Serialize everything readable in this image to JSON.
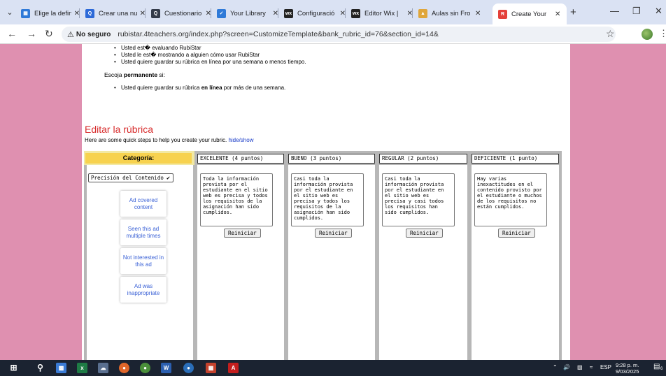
{
  "browser": {
    "tabs": [
      {
        "label": "Elige la defin",
        "icon": "microsoft-icon",
        "color": "#2f7ad8"
      },
      {
        "label": "Crear una nu",
        "icon": "quiz-icon",
        "color": "#2c69d8"
      },
      {
        "label": "Cuestionario",
        "icon": "quiz-icon",
        "color": "#333b4a"
      },
      {
        "label": "Your Library",
        "icon": "check-icon",
        "color": "#2f7ad8"
      },
      {
        "label": "Configuració",
        "icon": "wix-icon",
        "color": "#222222"
      },
      {
        "label": "Editor Wix |",
        "icon": "wix-icon",
        "color": "#222222"
      },
      {
        "label": "Aulas sin Fro",
        "icon": "aulas-icon",
        "color": "#e0a63a"
      },
      {
        "label": "Create Your",
        "icon": "rubistar-icon",
        "color": "#e4403a"
      }
    ],
    "address": {
      "security": "No seguro",
      "url": "rubistar.4teachers.org/index.php?screen=CustomizeTemplate&bank_rubric_id=76&section_id=14&"
    }
  },
  "page": {
    "bullets_top": [
      "Usted est� evaluando RubiStar",
      "Usted le est� mostrando a alguien cómo usar RubiStar",
      "Usted quiere guardar su rúbrica en línea por una semana o menos tiempo."
    ],
    "permanent_prefix": "Escoja ",
    "permanent_bold": "permanente",
    "permanent_suffix": " si:",
    "bullet_perm_a": "Usted quiere guardar su rúbrica ",
    "bullet_perm_bold": "en línea",
    "bullet_perm_b": " por más de una semana.",
    "edit_heading": "Editar la rúbrica",
    "help_text": "Here are some quick steps to help you create your rubric.",
    "help_link": "hide/show"
  },
  "rubric": {
    "category_header": "Categoría:",
    "category_selected": "Precisión del Contenido",
    "columns": [
      {
        "header": "EXCELENTE (4 puntos)",
        "text": "Toda la información provista por el estudiante en el sitio web es precisa y todos los requisitos de la asignación han sido cumplidos.",
        "reset": "Reiniciar"
      },
      {
        "header": "BUENO (3 puntos)",
        "text": "Casi toda la información provista por el estudiante en el sitio web es precisa y todos los requisitos de la asignación han sido cumplidos.",
        "reset": "Reiniciar"
      },
      {
        "header": "REGULAR (2 puntos)",
        "text": "Casi toda la información provista por el estudiante en el sitio web es precisa y casi todos los requisitos han sido cumplidos.",
        "reset": "Reiniciar"
      },
      {
        "header": "DEFICIENTE (1 punto)",
        "text": "Hay varias inexactitudes en el contenido provisto por el estudiante o muchos de los requisitos no están cumplidos.",
        "reset": "Reiniciar"
      }
    ],
    "ad_options": [
      "Ad covered content",
      "Seen this ad multiple times",
      "Not interested in this ad",
      "Ad was inappropriate"
    ]
  },
  "taskbar": {
    "language": "ESP",
    "time": "9:28 p. m.",
    "date": "9/03/2025",
    "notifications": "6"
  },
  "colors": {
    "page_background": "#df90b0",
    "heading_red": "#d72c2c",
    "category_header": "#f7d24f",
    "header_strip": "#f2e9a4",
    "link_blue": "#1a3cc8"
  }
}
